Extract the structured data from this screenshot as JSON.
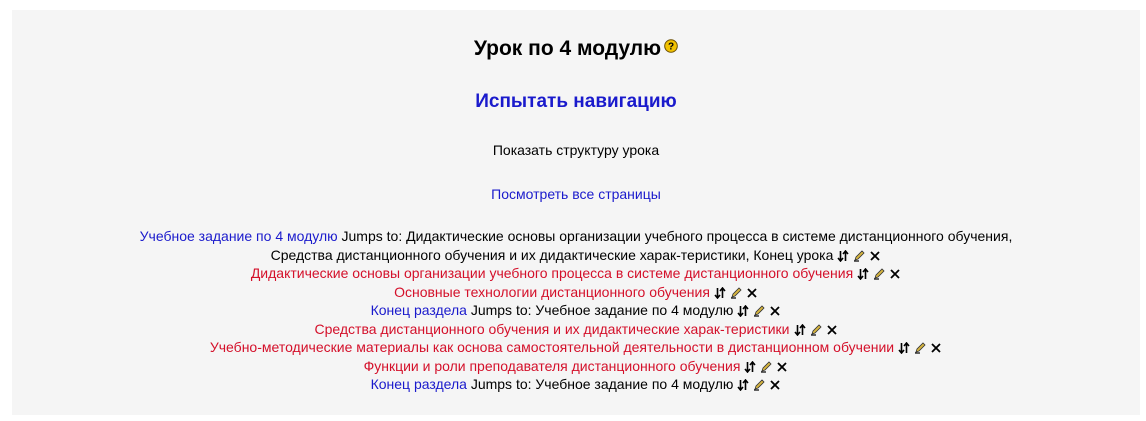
{
  "header": {
    "title": "Урок по 4 модулю",
    "help_icon": "help-icon"
  },
  "actions": {
    "test_navigation": "Испытать навигацию",
    "show_structure": "Показать структуру урока",
    "view_all_pages": "Посмотреть все страницы"
  },
  "icons": {
    "move": "move-icon",
    "edit": "edit-icon",
    "delete": "delete-icon"
  },
  "colors": {
    "link": "#1a1acc",
    "page_link": "#d4102a",
    "background": "#f5f5f5"
  },
  "pages": [
    {
      "title": "Учебное задание по 4 модулю",
      "jumps_line1": " Jumps to: Дидактические основы организации учебного процесса в системе дистанционного обучения,",
      "jumps_line2": "Средства дистанционного обучения и их дидактические харак-теристики, Конец урока"
    },
    {
      "title": "Дидактические основы организации учебного процесса в системе дистанционного обучения"
    },
    {
      "title": "Основные технологии дистанционного обучения"
    },
    {
      "title": "Конец раздела",
      "jumps": " Jumps to: Учебное задание по 4 модулю"
    },
    {
      "title": "Средства дистанционного обучения и их дидактические харак-теристики"
    },
    {
      "title": "Учебно-методические материалы как основа самостоятельной деятельности в дистанционном обучении"
    },
    {
      "title": "Функции и роли преподавателя дистанционного обучения"
    },
    {
      "title": "Конец раздела",
      "jumps": " Jumps to: Учебное задание по 4 модулю"
    }
  ]
}
